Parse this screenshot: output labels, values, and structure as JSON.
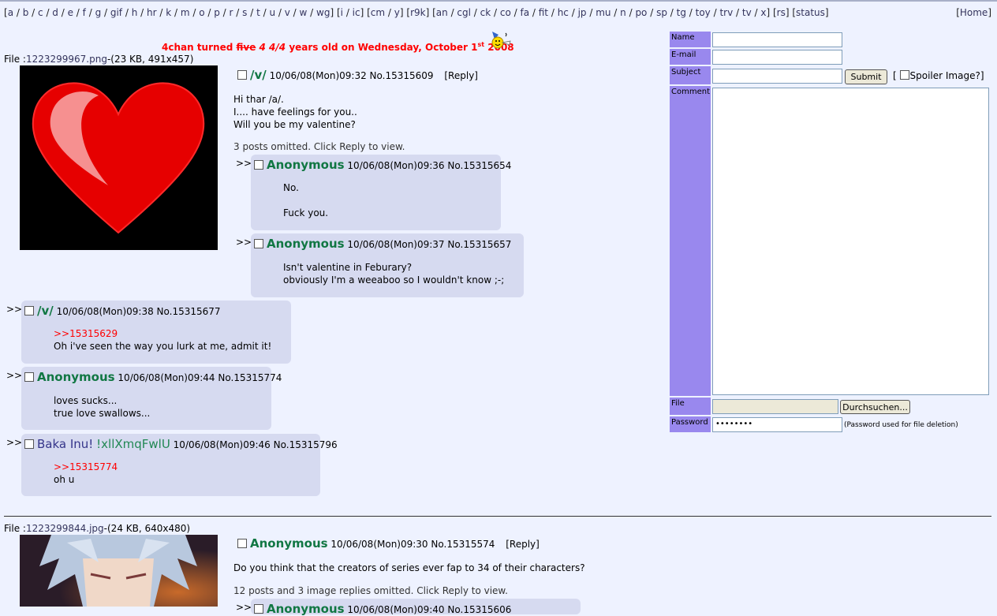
{
  "nav": {
    "links": [
      "a",
      "b",
      "c",
      "d",
      "e",
      "f",
      "g",
      "gif",
      "h",
      "hr",
      "k",
      "m",
      "o",
      "p",
      "r",
      "s",
      "t",
      "u",
      "v",
      "w",
      "wg"
    ],
    "group2": [
      "i",
      "ic"
    ],
    "group3": [
      "cm",
      "y"
    ],
    "group4": [
      "r9k"
    ],
    "group5": [
      "an",
      "cgl",
      "ck",
      "co",
      "fa",
      "fit",
      "hc",
      "jp",
      "mu",
      "n",
      "po",
      "sp",
      "tg",
      "toy",
      "trv",
      "tv",
      "x"
    ],
    "group6": [
      "rs"
    ],
    "group7": [
      "status"
    ],
    "home": "Home"
  },
  "announce": {
    "pre": "4chan turned ",
    "struck": "five",
    "italic": " 4 4/4",
    "mid": " years old on Wednesday, October 1",
    "sup": "st",
    "post": " 2008"
  },
  "thread1": {
    "file_label": "File :",
    "file_name": "1223299967.png",
    "file_meta": "-(23 KB, 491x457)",
    "op": {
      "name": "/v/",
      "date": "10/06/08(Mon)09:32",
      "no": "No.15315609",
      "reply": "[Reply]",
      "lines": [
        "Hi thar /a/.",
        "I.... have feelings for you..",
        "Will you be my valentine?"
      ],
      "omitted": "3 posts omitted. Click Reply to view."
    },
    "replies": [
      {
        "name": "Anonymous",
        "date": "10/06/08(Mon)09:36",
        "no": "No.15315654",
        "lines": [
          "No.",
          "",
          "Fuck you."
        ]
      },
      {
        "name": "Anonymous",
        "date": "10/06/08(Mon)09:37",
        "no": "No.15315657",
        "lines": [
          "Isn't valentine in Feburary?",
          "obviously I'm a weeaboo so I wouldn't know ;-;"
        ]
      },
      {
        "name": "/v/",
        "date": "10/06/08(Mon)09:38",
        "no": "No.15315677",
        "quote": ">>15315629",
        "lines": [
          "Oh i've seen the way you lurk at me, admit it!"
        ]
      },
      {
        "name": "Anonymous",
        "date": "10/06/08(Mon)09:44",
        "no": "No.15315774",
        "lines": [
          "loves sucks...",
          "true love swallows..."
        ]
      },
      {
        "name": "Baka Inu!",
        "trip": "!xllXmqFwlU",
        "date": "10/06/08(Mon)09:46",
        "no": "No.15315796",
        "quote": ">>15315774",
        "lines": [
          "oh u"
        ]
      }
    ]
  },
  "thread2": {
    "file_label": "File :",
    "file_name": "1223299844.jpg",
    "file_meta": "-(24 KB, 640x480)",
    "op": {
      "name": "Anonymous",
      "date": "10/06/08(Mon)09:30",
      "no": "No.15315574",
      "reply": "[Reply]",
      "lines": [
        "Do you think that the creators of series ever fap to 34 of their characters?"
      ],
      "omitted": "12 posts and 3 image replies omitted. Click Reply to view."
    },
    "partial_reply": {
      "name": "Anonymous",
      "date": "10/06/08(Mon)09:40",
      "no": "No.15315606"
    }
  },
  "arrows": ">>",
  "form": {
    "name_label": "Name",
    "email_label": "E-mail",
    "subject_label": "Subject",
    "comment_label": "Comment",
    "file_label": "File",
    "password_label": "Password",
    "submit": "Submit",
    "spoiler": "Spoiler Image?]",
    "spoiler_open": "[",
    "browse": "Durchsuchen...",
    "password_value": "••••••••",
    "password_note": "(Password used for file deletion)"
  },
  "colors": {
    "reply_bg": "#d6daf0",
    "name_green": "#117743",
    "quote_red": "#ff0000",
    "form_label": "#9988ee"
  }
}
